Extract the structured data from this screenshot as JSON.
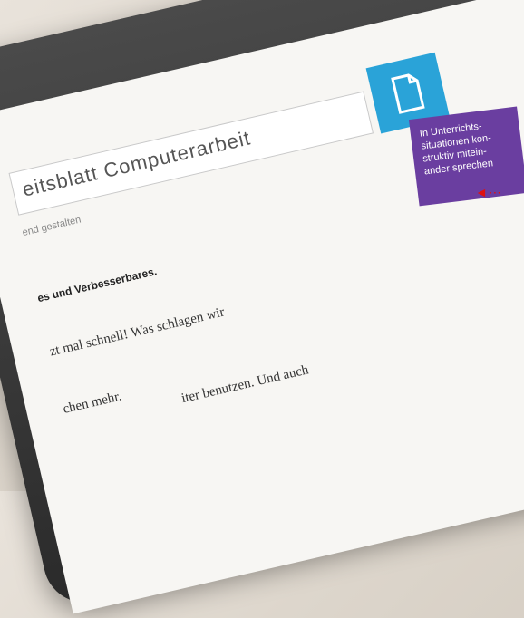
{
  "document": {
    "title": "eitsblatt Computerarbeit",
    "subtitle": "end gestalten",
    "lines": [
      "es und Verbesserbares.",
      "zt mal schnell! Was schlagen wir",
      "chen mehr.",
      "iter benutzen. Und auch"
    ]
  },
  "badge": {
    "lines": [
      "In Unterrichts-",
      "situationen kon-",
      "struktiv mitein-",
      "ander sprechen"
    ]
  },
  "arrow": "◄⋯"
}
